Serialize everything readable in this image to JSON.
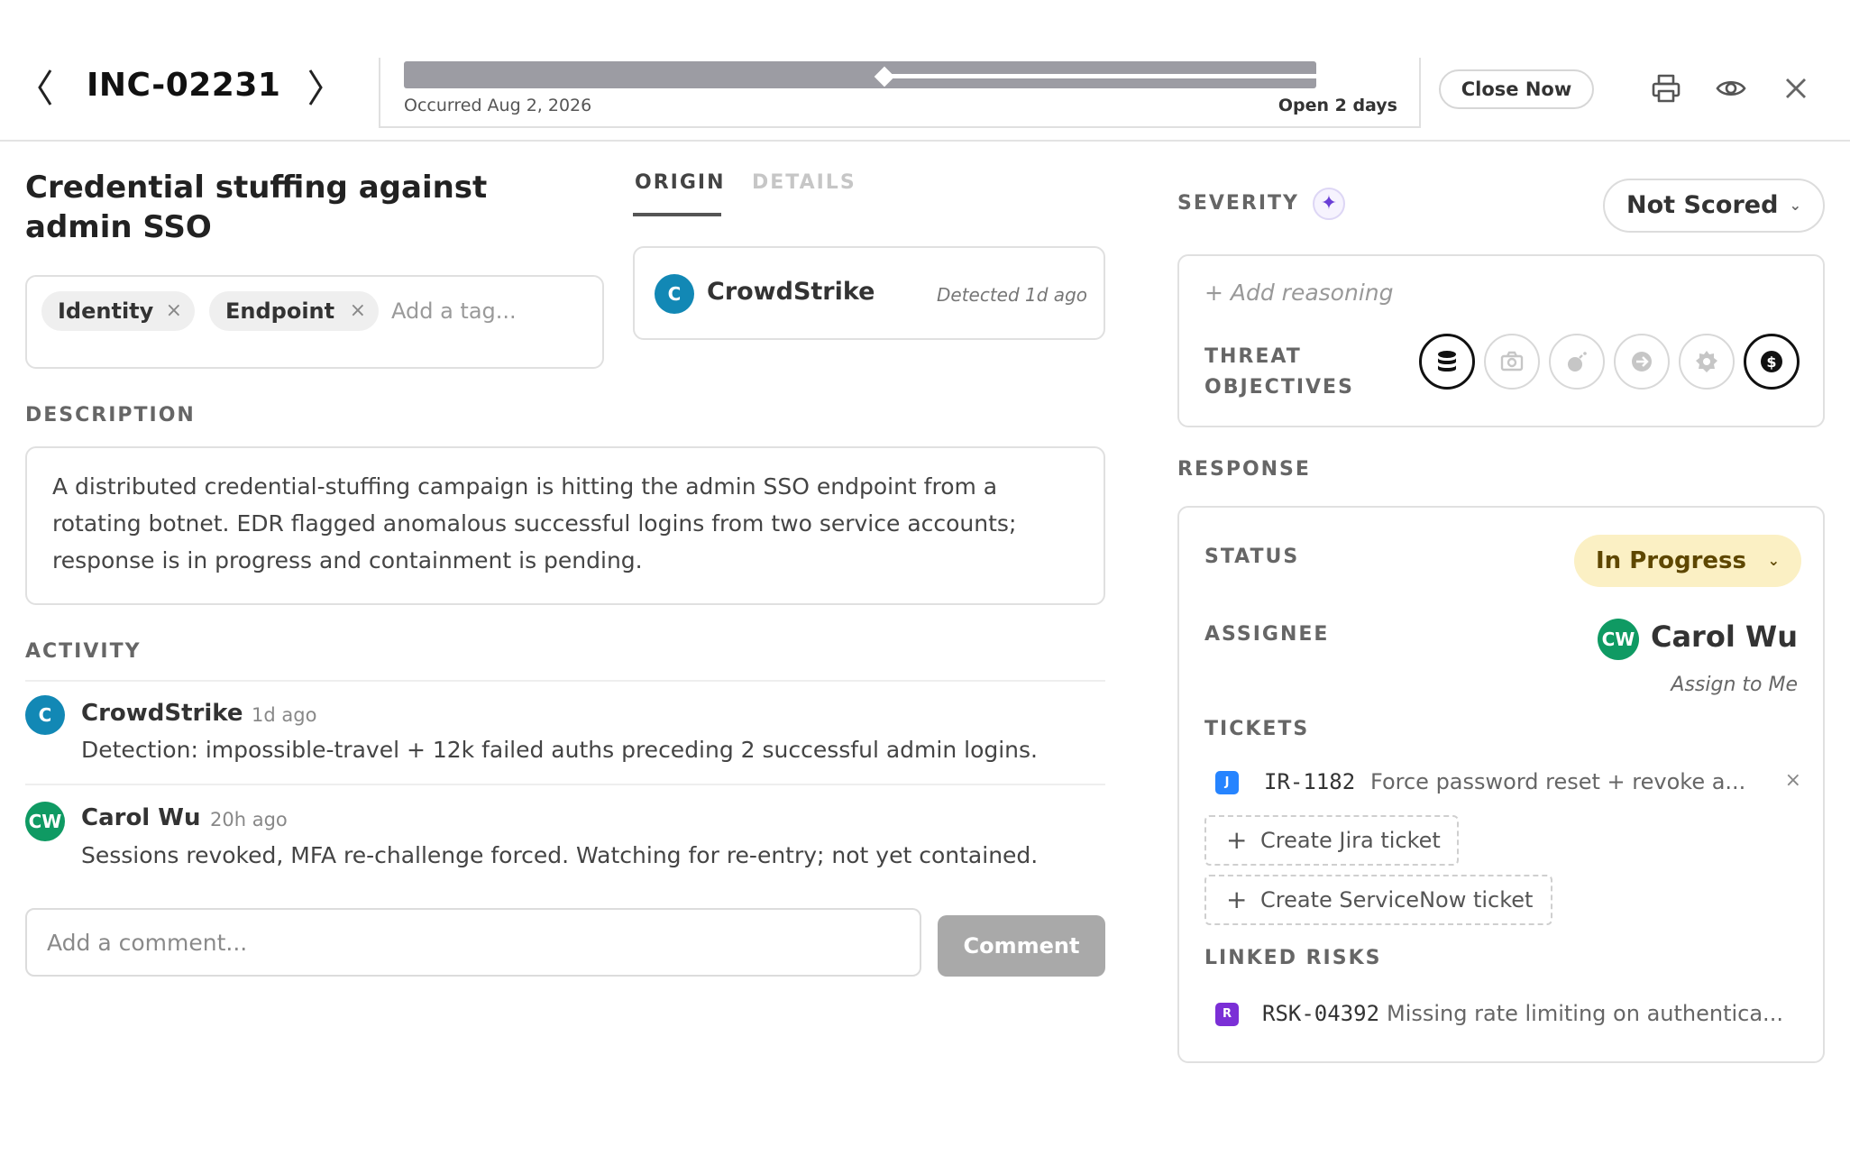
{
  "header": {
    "incident_id": "INC-02231",
    "timeline": {
      "occurred": "Occurred Aug 2, 2026",
      "open_duration": "Open 2 days"
    },
    "close_now_label": "Close Now"
  },
  "incident": {
    "title": "Credential stuffing against admin SSO",
    "tags": [
      "Identity",
      "Endpoint"
    ],
    "tag_placeholder": "Add a tag...",
    "tag_remove_glyph": "×"
  },
  "tabs": {
    "origin": "ORIGIN",
    "details": "DETAILS"
  },
  "origin": {
    "avatar_initial": "C",
    "source": "CrowdStrike",
    "detected": "Detected 1d ago"
  },
  "description": {
    "label": "DESCRIPTION",
    "text": "A distributed credential-stuffing campaign is hitting the admin SSO endpoint from a rotating botnet. EDR flagged anomalous successful logins from two service accounts; response is in progress and containment is pending."
  },
  "activity": {
    "label": "ACTIVITY",
    "entries": [
      {
        "initials": "C",
        "author": "CrowdStrike",
        "time": "1d ago",
        "text": "Detection: impossible-travel + 12k failed auths preceding 2 successful admin logins.",
        "avatar_color": "#1288b5"
      },
      {
        "initials": "CW",
        "author": "Carol Wu",
        "time": "20h ago",
        "text": "Sessions revoked, MFA re-challenge forced. Watching for re-entry; not yet contained.",
        "avatar_color": "#0f9a63"
      }
    ],
    "comment_placeholder": "Add a comment...",
    "comment_button": "Comment"
  },
  "severity": {
    "label": "SEVERITY",
    "sparkle_glyph": "✦",
    "score": "Not Scored",
    "add_reasoning": "+ Add reasoning",
    "threat_objectives_label": "THREAT OBJECTIVES",
    "threat_objectives": [
      {
        "icon": "database-icon",
        "active": true
      },
      {
        "icon": "camera-icon",
        "active": false
      },
      {
        "icon": "bomb-icon",
        "active": false
      },
      {
        "icon": "arrow-right-circle-icon",
        "active": false
      },
      {
        "icon": "gear-icon",
        "active": false
      },
      {
        "icon": "dollar-icon",
        "active": true
      }
    ]
  },
  "response": {
    "label": "RESPONSE",
    "status_label": "STATUS",
    "status": "In Progress",
    "status_color": "#fbf0c4",
    "assignee_label": "ASSIGNEE",
    "assignee_initials": "CW",
    "assignee_name": "Carol Wu",
    "assign_to_me": "Assign to Me",
    "tickets_label": "TICKETS",
    "tickets": [
      {
        "badge": "J",
        "id": "IR-1182",
        "title": "Force password reset + revoke a...",
        "remove_glyph": "×"
      }
    ],
    "create_jira": "Create Jira ticket",
    "create_servicenow": "Create ServiceNow ticket",
    "linked_risks_label": "LINKED RISKS",
    "linked_risks": [
      {
        "badge": "R",
        "id": "RSK-04392",
        "title": "Missing rate limiting on authentica..."
      }
    ]
  }
}
